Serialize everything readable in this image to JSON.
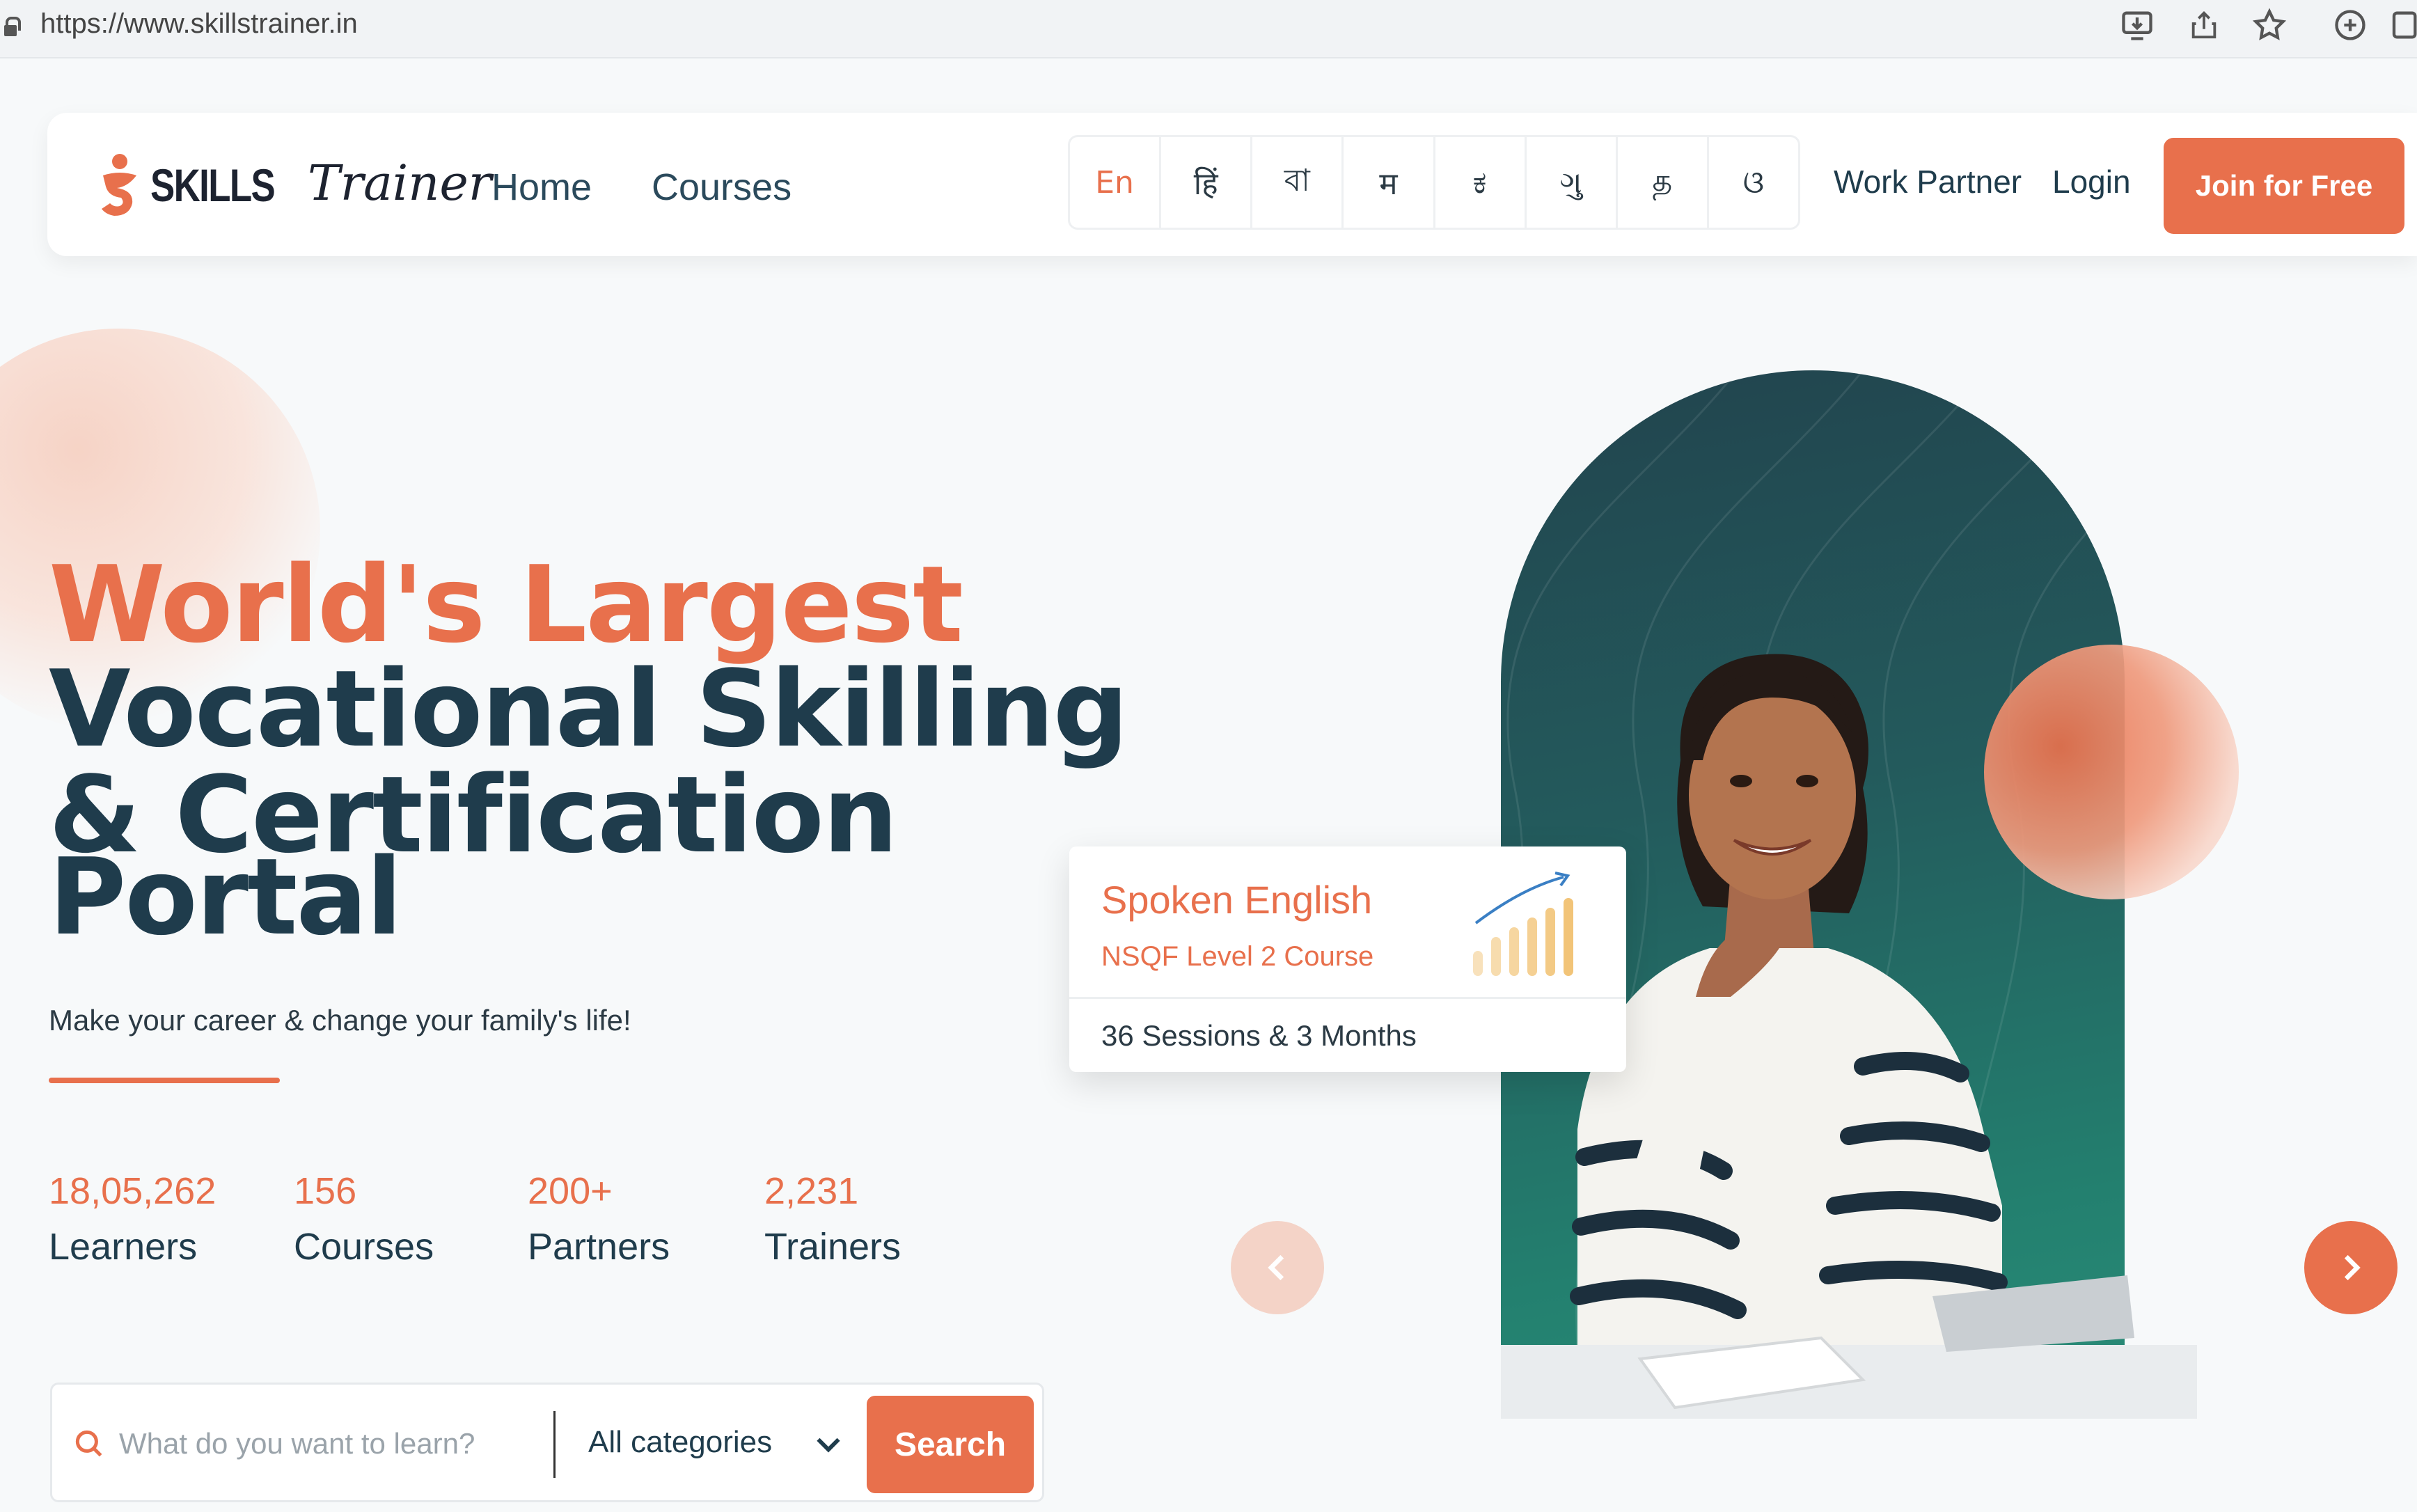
{
  "browser": {
    "url": "https://www.skillstrainer.in"
  },
  "brand": {
    "logo_text_skills": "SKILLS",
    "logo_text_trainer": "Trainer",
    "accent": "#e8704c",
    "dark": "#1f3c4c"
  },
  "nav": {
    "home": "Home",
    "courses": "Courses",
    "languages": [
      "En",
      "हिं",
      "বা",
      "म",
      "ಕ",
      "ગુ",
      "த",
      "ଓ"
    ],
    "active_language": "En",
    "work_partner": "Work Partner",
    "login": "Login",
    "join": "Join for Free"
  },
  "hero": {
    "line1": "World's Largest",
    "line2": "Vocational Skilling",
    "line3": "& Certification",
    "line4": "Portal",
    "tagline": "Make your career & change your family's life!"
  },
  "stats": [
    {
      "value": "18,05,262",
      "label": "Learners"
    },
    {
      "value": "156",
      "label": "Courses"
    },
    {
      "value": "200+",
      "label": "Partners"
    },
    {
      "value": "2,231",
      "label": "Trainers"
    }
  ],
  "search": {
    "placeholder": "What do you want to learn?",
    "category": "All categories",
    "button": "Search"
  },
  "course_card": {
    "title": "Spoken English",
    "subtitle": "NSQF Level 2 Course",
    "meta": "36 Sessions & 3 Months"
  },
  "icons": {
    "lock": "lock-icon",
    "search": "search-icon",
    "chevron": "chevron-down-icon",
    "prev": "chevron-left-icon",
    "next": "chevron-right-icon"
  }
}
